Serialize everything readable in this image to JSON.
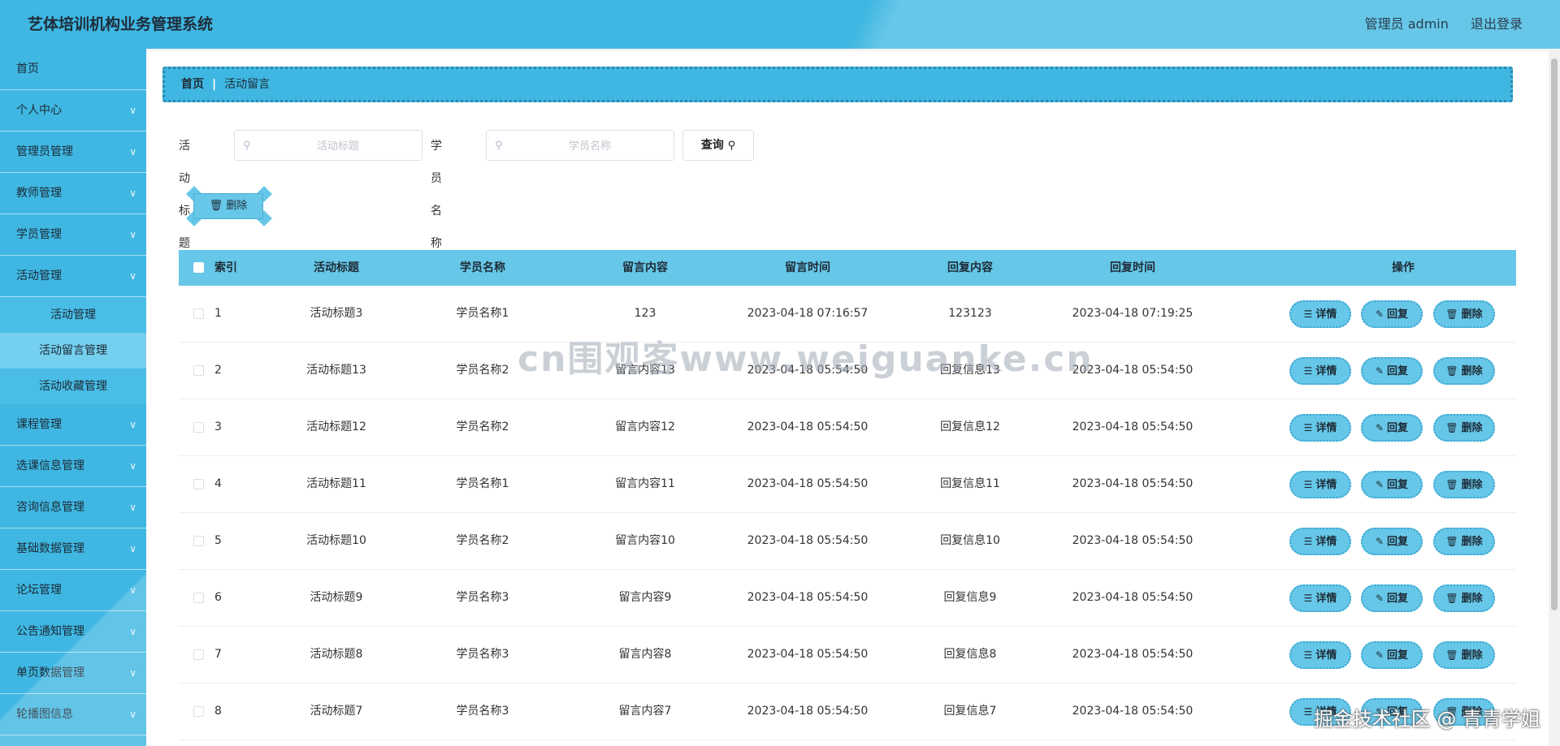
{
  "header": {
    "title": "艺体培训机构业务管理系统",
    "user_label": "管理员 admin",
    "logout_label": "退出登录"
  },
  "sidebar": {
    "items": [
      {
        "label": "首页",
        "chevron": false
      },
      {
        "label": "个人中心",
        "chevron": true
      },
      {
        "label": "管理员管理",
        "chevron": true
      },
      {
        "label": "教师管理",
        "chevron": true
      },
      {
        "label": "学员管理",
        "chevron": true
      },
      {
        "label": "活动管理",
        "chevron": true
      },
      {
        "label": "课程管理",
        "chevron": true
      },
      {
        "label": "选课信息管理",
        "chevron": true
      },
      {
        "label": "咨询信息管理",
        "chevron": true
      },
      {
        "label": "基础数据管理",
        "chevron": true
      },
      {
        "label": "论坛管理",
        "chevron": true
      },
      {
        "label": "公告通知管理",
        "chevron": true
      },
      {
        "label": "单页数据管理",
        "chevron": true
      },
      {
        "label": "轮播图信息",
        "chevron": true
      }
    ],
    "sub_items": [
      {
        "label": "活动管理"
      },
      {
        "label": "活动留言管理"
      },
      {
        "label": "活动收藏管理"
      }
    ]
  },
  "breadcrumb": {
    "home": "首页",
    "current": "活动留言"
  },
  "search": {
    "title_label": "活动标题",
    "title_placeholder": "活动标题",
    "name_label": "学员名称",
    "name_placeholder": "学员名称",
    "query_label": "查询"
  },
  "toolbar": {
    "delete_label": "删除"
  },
  "table": {
    "headers": [
      "索引",
      "活动标题",
      "学员名称",
      "留言内容",
      "留言时间",
      "回复内容",
      "回复时间",
      "操作"
    ],
    "actions": {
      "detail": "详情",
      "reply": "回复",
      "delete": "删除"
    },
    "rows": [
      [
        "1",
        "活动标题3",
        "学员名称1",
        "123",
        "2023-04-18 07:16:57",
        "123123",
        "2023-04-18 07:19:25"
      ],
      [
        "2",
        "活动标题13",
        "学员名称2",
        "留言内容13",
        "2023-04-18 05:54:50",
        "回复信息13",
        "2023-04-18 05:54:50"
      ],
      [
        "3",
        "活动标题12",
        "学员名称2",
        "留言内容12",
        "2023-04-18 05:54:50",
        "回复信息12",
        "2023-04-18 05:54:50"
      ],
      [
        "4",
        "活动标题11",
        "学员名称1",
        "留言内容11",
        "2023-04-18 05:54:50",
        "回复信息11",
        "2023-04-18 05:54:50"
      ],
      [
        "5",
        "活动标题10",
        "学员名称2",
        "留言内容10",
        "2023-04-18 05:54:50",
        "回复信息10",
        "2023-04-18 05:54:50"
      ],
      [
        "6",
        "活动标题9",
        "学员名称3",
        "留言内容9",
        "2023-04-18 05:54:50",
        "回复信息9",
        "2023-04-18 05:54:50"
      ],
      [
        "7",
        "活动标题8",
        "学员名称3",
        "留言内容8",
        "2023-04-18 05:54:50",
        "回复信息8",
        "2023-04-18 05:54:50"
      ],
      [
        "8",
        "活动标题7",
        "学员名称3",
        "留言内容7",
        "2023-04-18 05:54:50",
        "回复信息7",
        "2023-04-18 05:54:50"
      ]
    ]
  },
  "overlay": {
    "watermark": "cn围观客www.weiguanke.cn",
    "credit": "掘金技术社区 @ 青青学姐"
  },
  "icons": {
    "search": "search-icon",
    "chevron": "chevron-down-icon",
    "trash": "trash-icon",
    "document": "document-icon",
    "edit": "edit-icon"
  },
  "colors": {
    "primary": "#3fb7e2",
    "primary_light": "#67c7e8",
    "sub_active": "#75cfee"
  }
}
